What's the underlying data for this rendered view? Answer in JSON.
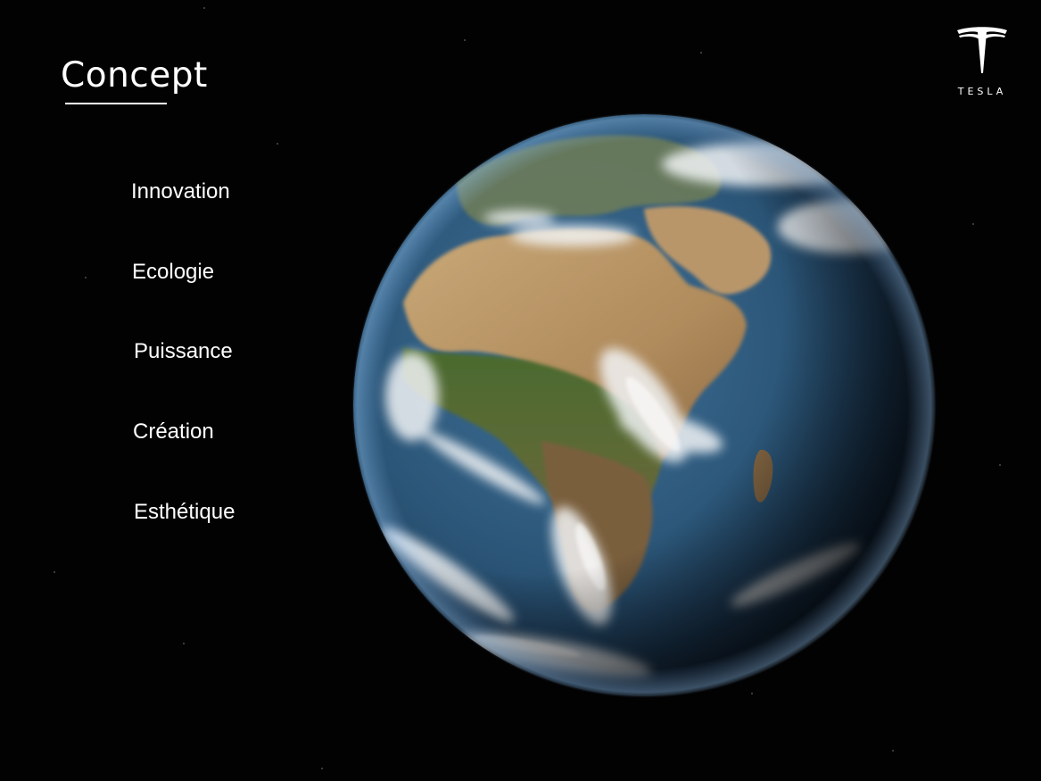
{
  "slide": {
    "title": "Concept",
    "menu": [
      "Innovation",
      "Ecologie",
      "Puissance",
      "Création",
      "Esthétique"
    ]
  },
  "logo": {
    "wordmark": "TESLA",
    "icon": "tesla-t-icon"
  },
  "background": {
    "image": "earth-from-space-africa"
  },
  "colors": {
    "background": "#020203",
    "text": "#ffffff",
    "ocean": "#2f5d86",
    "land": "#b89868",
    "vegetation": "#4f6e2f"
  }
}
